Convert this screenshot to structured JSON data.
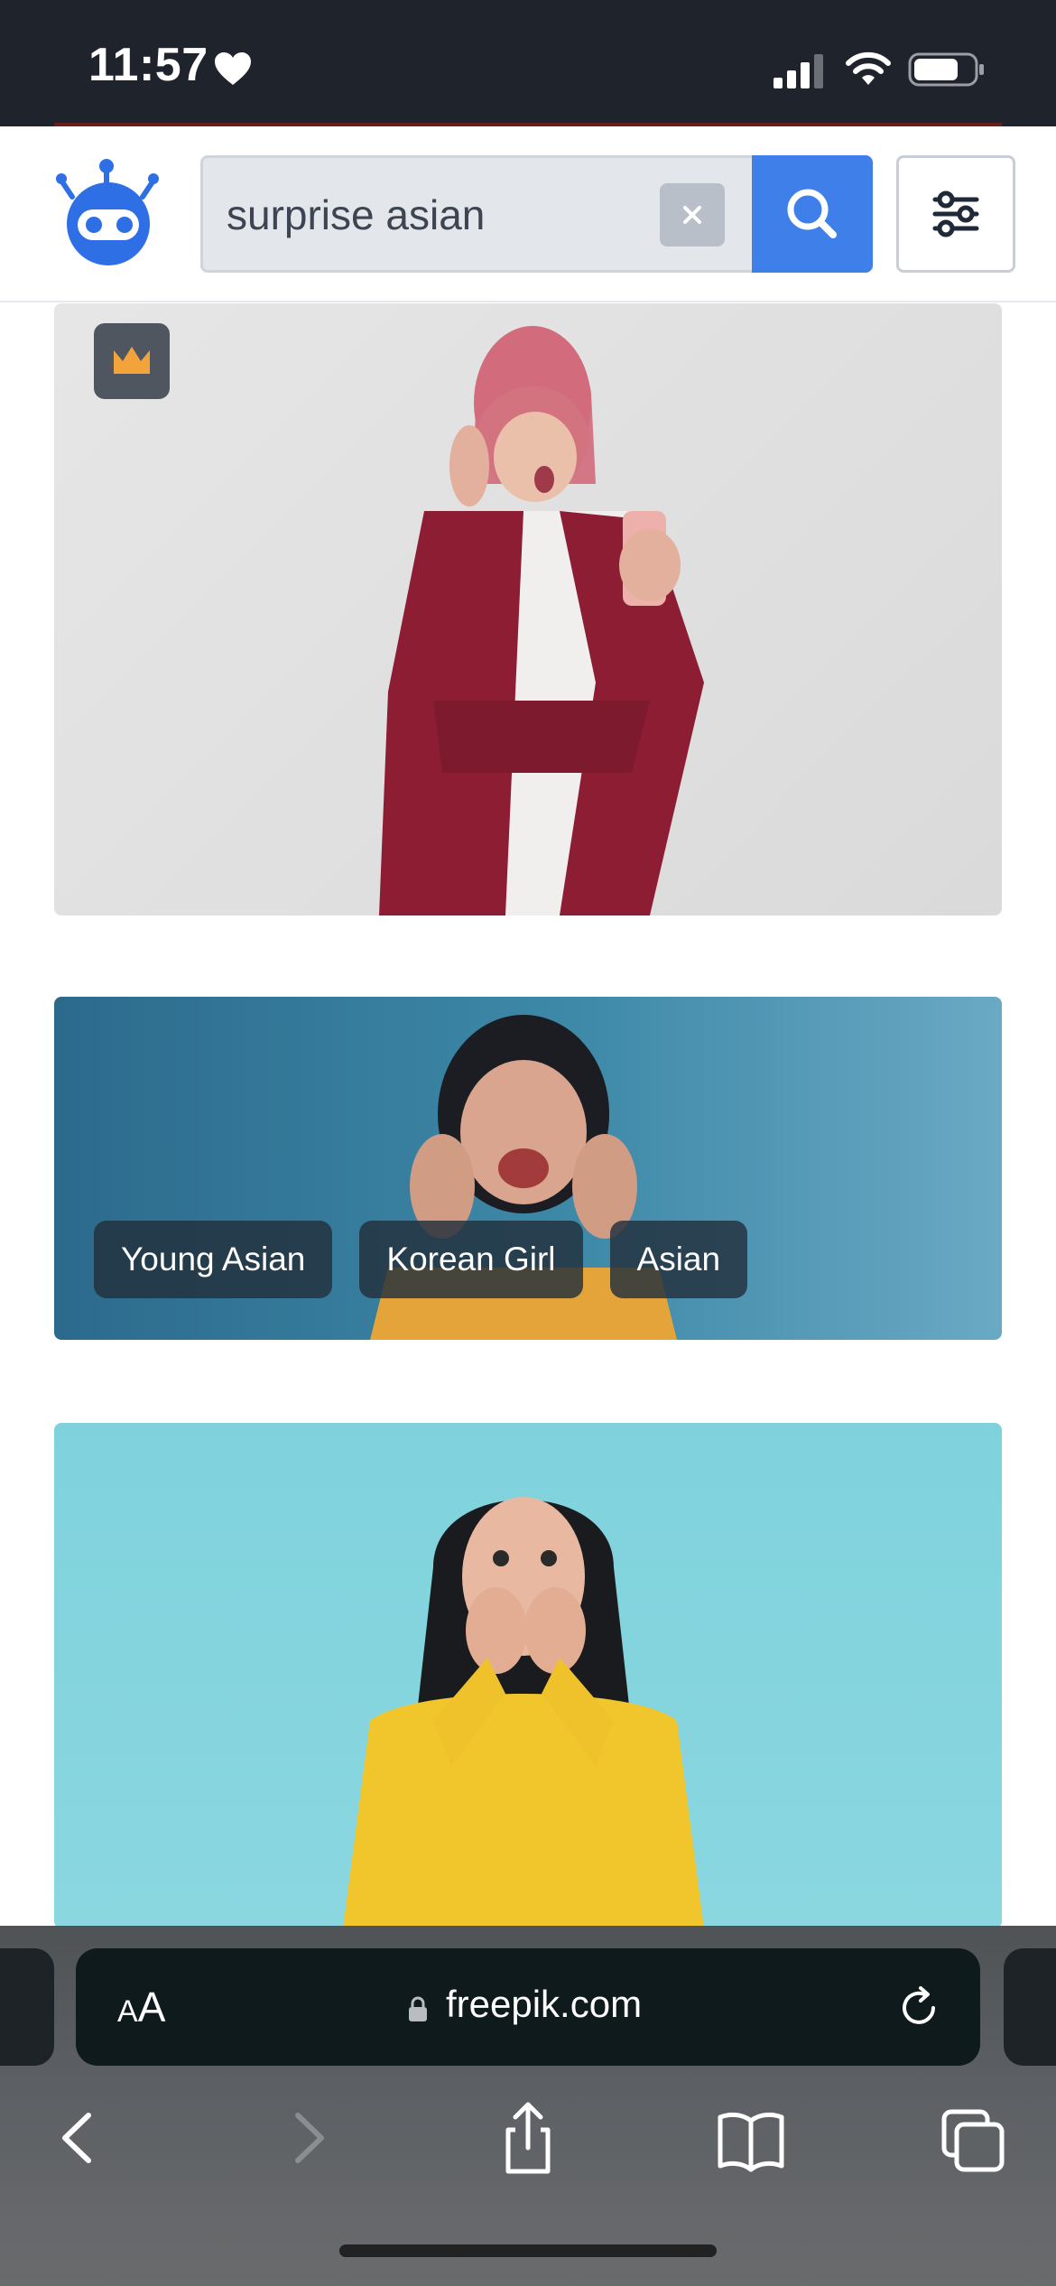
{
  "status_bar": {
    "time": "11:57"
  },
  "search": {
    "query": "surprise asian"
  },
  "results": [
    {
      "premium": true
    },
    {
      "tags": [
        "Young Asian",
        "Korean Girl",
        "Asian"
      ]
    },
    {}
  ],
  "browser": {
    "aa_small": "A",
    "aa_large": "A",
    "url": "freepik.com"
  },
  "colors": {
    "accent": "#3f7fe9",
    "status_bar": "#1f232b",
    "premium_crown": "#f2a43a"
  },
  "icons": [
    "heart-icon",
    "signal-icon",
    "wifi-icon",
    "battery-icon",
    "freepik-logo-icon",
    "clear-icon",
    "search-icon",
    "filter-sliders-icon",
    "crown-icon",
    "lock-icon",
    "reload-icon",
    "back-icon",
    "forward-icon",
    "share-icon",
    "bookmarks-icon",
    "tabs-icon"
  ]
}
